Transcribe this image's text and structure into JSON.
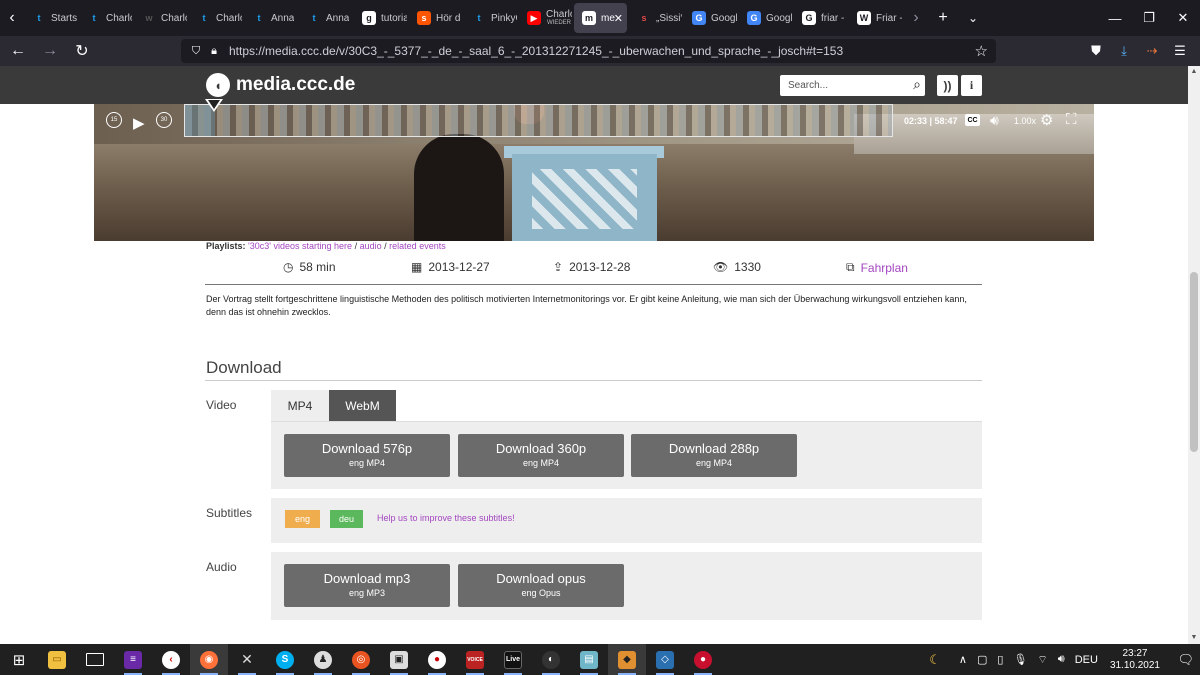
{
  "browser": {
    "tabs": [
      {
        "title": "Startse",
        "icon": "twitter-icon",
        "color": "#1da1f2",
        "glyph": "t"
      },
      {
        "title": "Charlo",
        "icon": "twitter-icon",
        "color": "#1da1f2",
        "glyph": "t"
      },
      {
        "title": "Charlo",
        "icon": "app-icon",
        "color": "#555555",
        "glyph": "w"
      },
      {
        "title": "Charlo",
        "icon": "twitter-icon",
        "color": "#1da1f2",
        "glyph": "t"
      },
      {
        "title": "Anna",
        "icon": "twitter-icon",
        "color": "#1da1f2",
        "glyph": "t"
      },
      {
        "title": "Anna",
        "icon": "twitter-icon",
        "color": "#1da1f2",
        "glyph": "t"
      },
      {
        "title": "tutoria",
        "icon": "github-icon",
        "color": "#ffffff",
        "glyph": "g"
      },
      {
        "title": "Hör d",
        "icon": "soundcloud-icon",
        "color": "#ff5500",
        "glyph": "s"
      },
      {
        "title": "PinkyC",
        "icon": "twitter-icon",
        "color": "#1da1f2",
        "glyph": "t"
      },
      {
        "title": "Charlo",
        "subtitle": "WIEDER",
        "icon": "youtube-icon",
        "color": "#ff0000",
        "glyph": "▶"
      },
      {
        "title": "me",
        "icon": "mediaccc-icon",
        "color": "#ffffff",
        "glyph": "m",
        "active": true
      },
      {
        "title": "„Sissi“",
        "icon": "app-icon",
        "color": "#e04848",
        "glyph": "s"
      },
      {
        "title": "Googl",
        "icon": "google-translate-icon",
        "color": "#4285f4",
        "glyph": "G"
      },
      {
        "title": "Googl",
        "icon": "google-translate-icon",
        "color": "#4285f4",
        "glyph": "G"
      },
      {
        "title": "friar -",
        "icon": "google-icon",
        "color": "#ffffff",
        "glyph": "G"
      },
      {
        "title": "Friar -",
        "icon": "wikipedia-icon",
        "color": "#ffffff",
        "glyph": "W"
      }
    ],
    "url": "https://media.ccc.de/v/30C3_-_5377_-_de_-_saal_6_-_201312271245_-_uberwachen_und_sprache_-_josch#t=153"
  },
  "site": {
    "logo_text": "media.ccc.de",
    "search_placeholder": "Search..."
  },
  "player": {
    "time": "02:33 | 58:47",
    "cc": "CC",
    "speed": "1.00x",
    "rewind_label": "15",
    "forward_label": "30",
    "progress_fraction": 0.043
  },
  "event": {
    "playlists_label": "Playlists:",
    "playlist_links": [
      "'30c3' videos starting here",
      "audio",
      "related events"
    ],
    "duration": "58 min",
    "date": "2013-12-27",
    "release_date": "2013-12-28",
    "views": "1330",
    "fahrplan": "Fahrplan",
    "description": "Der Vortrag stellt fortgeschrittene linguistische Methoden des politisch motivierten Internetmonitorings vor. Er gibt keine Anleitung, wie man sich der Überwachung wirkungsvoll entziehen kann, denn das ist ohnehin zwecklos."
  },
  "download": {
    "title": "Download",
    "video_label": "Video",
    "format_tabs": [
      "MP4",
      "WebM"
    ],
    "video_buttons": [
      {
        "label": "Download 576p",
        "sub": "eng MP4"
      },
      {
        "label": "Download 360p",
        "sub": "eng MP4"
      },
      {
        "label": "Download 288p",
        "sub": "eng MP4"
      }
    ],
    "subtitles_label": "Subtitles",
    "subtitle_langs": [
      "eng",
      "deu"
    ],
    "subtitle_help": "Help us to improve these subtitles!",
    "audio_label": "Audio",
    "audio_buttons": [
      {
        "label": "Download mp3",
        "sub": "eng MP3"
      },
      {
        "label": "Download opus",
        "sub": "eng Opus"
      }
    ]
  },
  "taskbar": {
    "language": "DEU",
    "time": "23:27",
    "date": "31.10.2021"
  },
  "colors": {
    "accent": "#a447c0",
    "header": "#3a3a3a",
    "button": "#6b6b6b"
  }
}
